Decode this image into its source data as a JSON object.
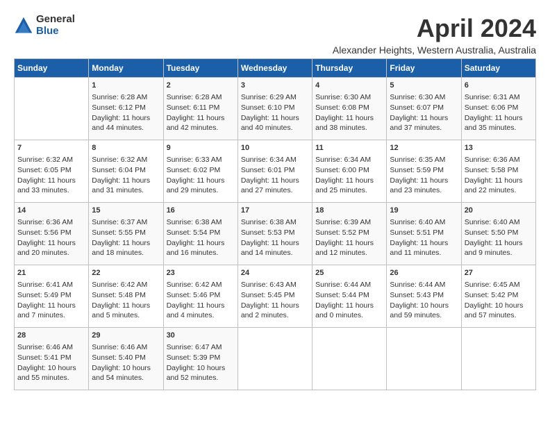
{
  "logo": {
    "general": "General",
    "blue": "Blue"
  },
  "title": "April 2024",
  "location": "Alexander Heights, Western Australia, Australia",
  "headers": [
    "Sunday",
    "Monday",
    "Tuesday",
    "Wednesday",
    "Thursday",
    "Friday",
    "Saturday"
  ],
  "weeks": [
    [
      {
        "day": "",
        "content": ""
      },
      {
        "day": "1",
        "content": "Sunrise: 6:28 AM\nSunset: 6:12 PM\nDaylight: 11 hours\nand 44 minutes."
      },
      {
        "day": "2",
        "content": "Sunrise: 6:28 AM\nSunset: 6:11 PM\nDaylight: 11 hours\nand 42 minutes."
      },
      {
        "day": "3",
        "content": "Sunrise: 6:29 AM\nSunset: 6:10 PM\nDaylight: 11 hours\nand 40 minutes."
      },
      {
        "day": "4",
        "content": "Sunrise: 6:30 AM\nSunset: 6:08 PM\nDaylight: 11 hours\nand 38 minutes."
      },
      {
        "day": "5",
        "content": "Sunrise: 6:30 AM\nSunset: 6:07 PM\nDaylight: 11 hours\nand 37 minutes."
      },
      {
        "day": "6",
        "content": "Sunrise: 6:31 AM\nSunset: 6:06 PM\nDaylight: 11 hours\nand 35 minutes."
      }
    ],
    [
      {
        "day": "7",
        "content": "Sunrise: 6:32 AM\nSunset: 6:05 PM\nDaylight: 11 hours\nand 33 minutes."
      },
      {
        "day": "8",
        "content": "Sunrise: 6:32 AM\nSunset: 6:04 PM\nDaylight: 11 hours\nand 31 minutes."
      },
      {
        "day": "9",
        "content": "Sunrise: 6:33 AM\nSunset: 6:02 PM\nDaylight: 11 hours\nand 29 minutes."
      },
      {
        "day": "10",
        "content": "Sunrise: 6:34 AM\nSunset: 6:01 PM\nDaylight: 11 hours\nand 27 minutes."
      },
      {
        "day": "11",
        "content": "Sunrise: 6:34 AM\nSunset: 6:00 PM\nDaylight: 11 hours\nand 25 minutes."
      },
      {
        "day": "12",
        "content": "Sunrise: 6:35 AM\nSunset: 5:59 PM\nDaylight: 11 hours\nand 23 minutes."
      },
      {
        "day": "13",
        "content": "Sunrise: 6:36 AM\nSunset: 5:58 PM\nDaylight: 11 hours\nand 22 minutes."
      }
    ],
    [
      {
        "day": "14",
        "content": "Sunrise: 6:36 AM\nSunset: 5:56 PM\nDaylight: 11 hours\nand 20 minutes."
      },
      {
        "day": "15",
        "content": "Sunrise: 6:37 AM\nSunset: 5:55 PM\nDaylight: 11 hours\nand 18 minutes."
      },
      {
        "day": "16",
        "content": "Sunrise: 6:38 AM\nSunset: 5:54 PM\nDaylight: 11 hours\nand 16 minutes."
      },
      {
        "day": "17",
        "content": "Sunrise: 6:38 AM\nSunset: 5:53 PM\nDaylight: 11 hours\nand 14 minutes."
      },
      {
        "day": "18",
        "content": "Sunrise: 6:39 AM\nSunset: 5:52 PM\nDaylight: 11 hours\nand 12 minutes."
      },
      {
        "day": "19",
        "content": "Sunrise: 6:40 AM\nSunset: 5:51 PM\nDaylight: 11 hours\nand 11 minutes."
      },
      {
        "day": "20",
        "content": "Sunrise: 6:40 AM\nSunset: 5:50 PM\nDaylight: 11 hours\nand 9 minutes."
      }
    ],
    [
      {
        "day": "21",
        "content": "Sunrise: 6:41 AM\nSunset: 5:49 PM\nDaylight: 11 hours\nand 7 minutes."
      },
      {
        "day": "22",
        "content": "Sunrise: 6:42 AM\nSunset: 5:48 PM\nDaylight: 11 hours\nand 5 minutes."
      },
      {
        "day": "23",
        "content": "Sunrise: 6:42 AM\nSunset: 5:46 PM\nDaylight: 11 hours\nand 4 minutes."
      },
      {
        "day": "24",
        "content": "Sunrise: 6:43 AM\nSunset: 5:45 PM\nDaylight: 11 hours\nand 2 minutes."
      },
      {
        "day": "25",
        "content": "Sunrise: 6:44 AM\nSunset: 5:44 PM\nDaylight: 11 hours\nand 0 minutes."
      },
      {
        "day": "26",
        "content": "Sunrise: 6:44 AM\nSunset: 5:43 PM\nDaylight: 10 hours\nand 59 minutes."
      },
      {
        "day": "27",
        "content": "Sunrise: 6:45 AM\nSunset: 5:42 PM\nDaylight: 10 hours\nand 57 minutes."
      }
    ],
    [
      {
        "day": "28",
        "content": "Sunrise: 6:46 AM\nSunset: 5:41 PM\nDaylight: 10 hours\nand 55 minutes."
      },
      {
        "day": "29",
        "content": "Sunrise: 6:46 AM\nSunset: 5:40 PM\nDaylight: 10 hours\nand 54 minutes."
      },
      {
        "day": "30",
        "content": "Sunrise: 6:47 AM\nSunset: 5:39 PM\nDaylight: 10 hours\nand 52 minutes."
      },
      {
        "day": "",
        "content": ""
      },
      {
        "day": "",
        "content": ""
      },
      {
        "day": "",
        "content": ""
      },
      {
        "day": "",
        "content": ""
      }
    ]
  ]
}
